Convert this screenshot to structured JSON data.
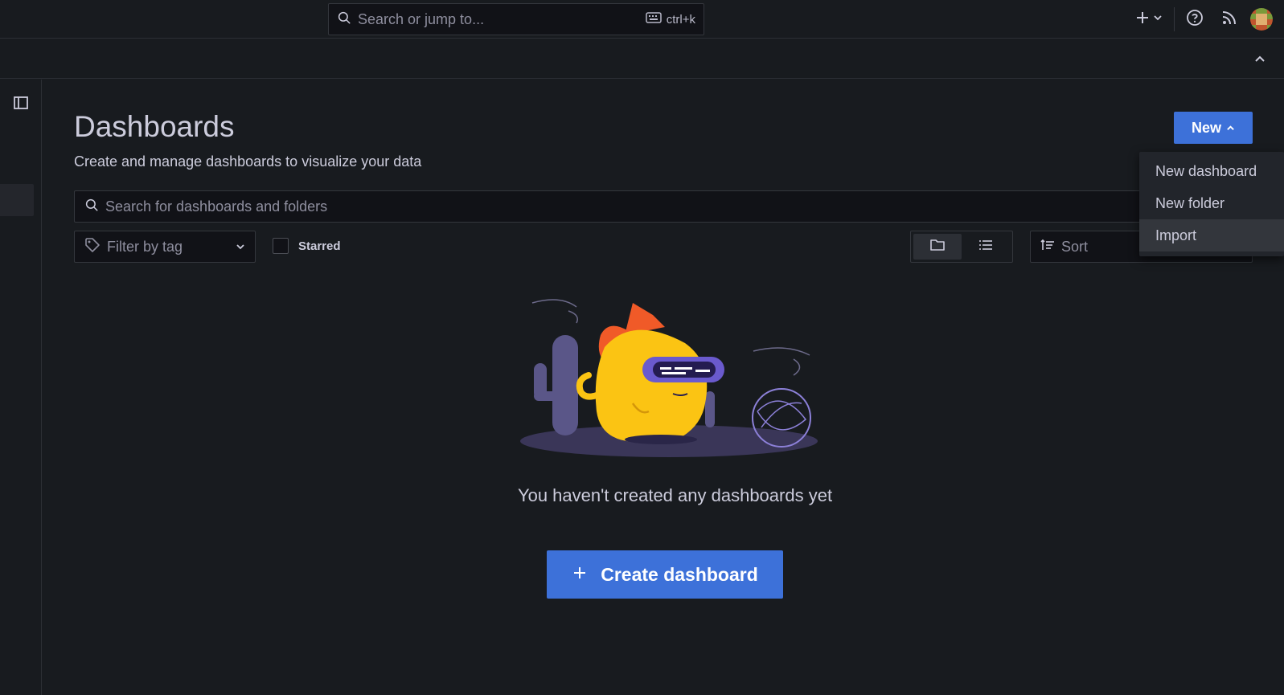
{
  "topbar": {
    "search_placeholder": "Search or jump to...",
    "search_shortcut": "ctrl+k",
    "icons": [
      "plus-icon",
      "chevron-down-icon",
      "help-icon",
      "rss-icon",
      "avatar"
    ]
  },
  "page": {
    "title": "Dashboards",
    "subtitle": "Create and manage dashboards to visualize your data",
    "new_button": "New"
  },
  "new_menu": {
    "items": [
      "New dashboard",
      "New folder",
      "Import"
    ],
    "hovered": "Import"
  },
  "filters": {
    "search_placeholder": "Search for dashboards and folders",
    "tag_placeholder": "Filter by tag",
    "starred_label": "Starred",
    "starred_checked": false,
    "sort_placeholder": "Sort",
    "view": "folders"
  },
  "empty_state": {
    "message": "You haven't created any dashboards yet",
    "create_button": "Create dashboard"
  },
  "colors": {
    "background": "#181b1f",
    "primary": "#3d71d9",
    "border": "#34373d",
    "text": "#ccccdc"
  }
}
